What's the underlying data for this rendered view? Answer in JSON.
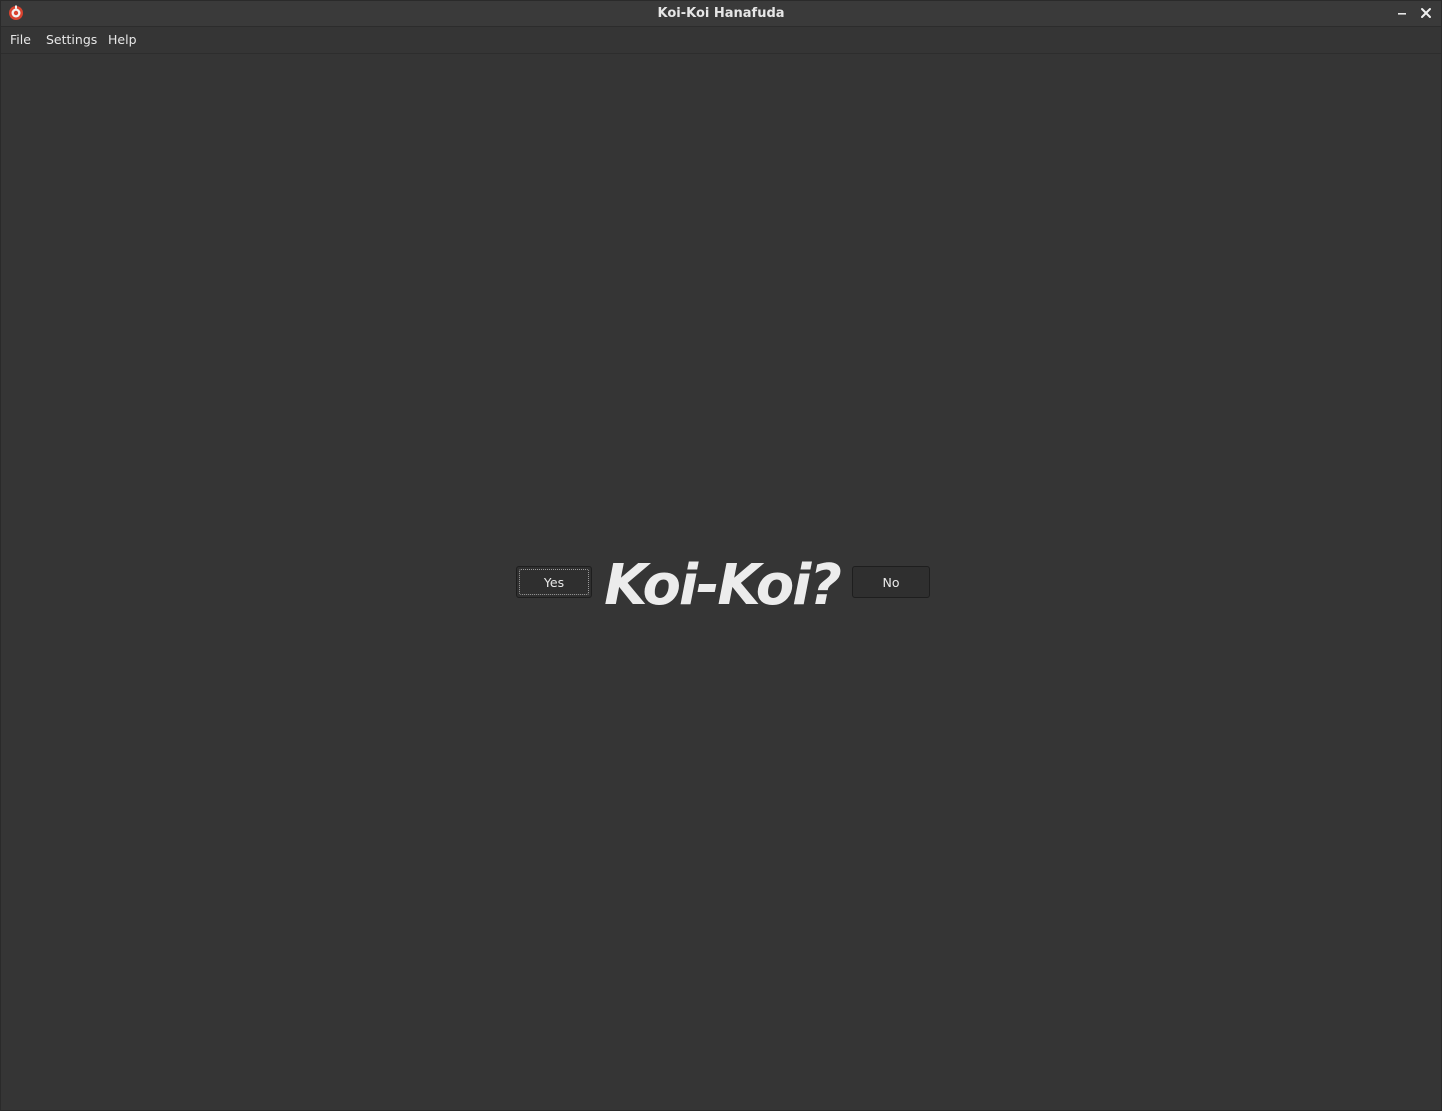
{
  "window": {
    "title": "Koi-Koi Hanafuda",
    "icon": "hanafuda-app-icon",
    "controls": {
      "minimize_icon": "minimize-icon",
      "close_icon": "close-icon"
    }
  },
  "menubar": {
    "items": [
      {
        "label": "File"
      },
      {
        "label": "Settings"
      },
      {
        "label": "Help"
      }
    ]
  },
  "prompt": {
    "question": "Koi-Koi?",
    "yes_label": "Yes",
    "no_label": "No",
    "focused_button": "Yes"
  },
  "colors": {
    "background": "#353535",
    "titlebar": "#3a3a3a",
    "text": "#ececec",
    "button_bg": "#2f2f2f",
    "icon_red": "#d9432f"
  }
}
